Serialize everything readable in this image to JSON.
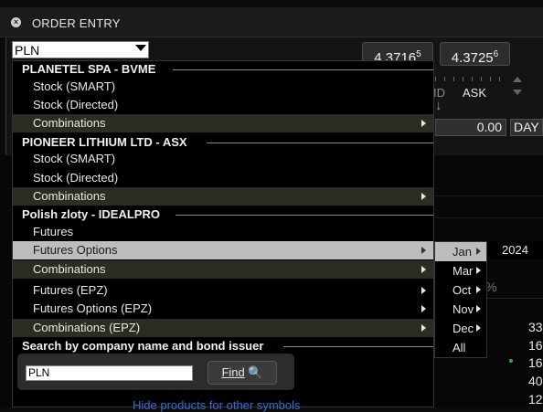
{
  "window": {
    "title": "ORDER ENTRY"
  },
  "symbol": {
    "value": "PLN"
  },
  "quote": {
    "bid": "4.3716",
    "bid_sup": "5",
    "ask": "4.3725",
    "ask_sup": "6",
    "bid_label": "ID",
    "ask_label": "ASK"
  },
  "order": {
    "price": "0.00",
    "tif": "DAY"
  },
  "groups": [
    {
      "header": "PLANETEL SPA - BVME",
      "items": [
        "Stock (SMART)",
        "Stock (Directed)",
        "Combinations"
      ]
    },
    {
      "header": "PIONEER LITHIUM LTD - ASX",
      "items": [
        "Stock (SMART)",
        "Stock (Directed)",
        "Combinations"
      ]
    },
    {
      "header": "Polish zloty - IDEALPRO",
      "items": [
        "Futures",
        "Futures Options",
        "Combinations",
        "Futures (EPZ)",
        "Futures Options (EPZ)",
        "Combinations (EPZ)"
      ]
    }
  ],
  "search": {
    "header": "Search by company name and bond issuer",
    "value": "PLN",
    "find_label": "Find",
    "hide_link": "Hide products for other symbols"
  },
  "submenu": {
    "items": [
      "Jan",
      "Mar",
      "Oct",
      "Nov",
      "Dec",
      "All"
    ],
    "year": "2024"
  },
  "right_values": [
    "33",
    "16",
    "16",
    "40",
    "12"
  ],
  "pct": "%",
  "colors": {
    "selection": "#bdbdbd",
    "combo_row": "#2c2c22",
    "link": "#2f6fd6"
  }
}
